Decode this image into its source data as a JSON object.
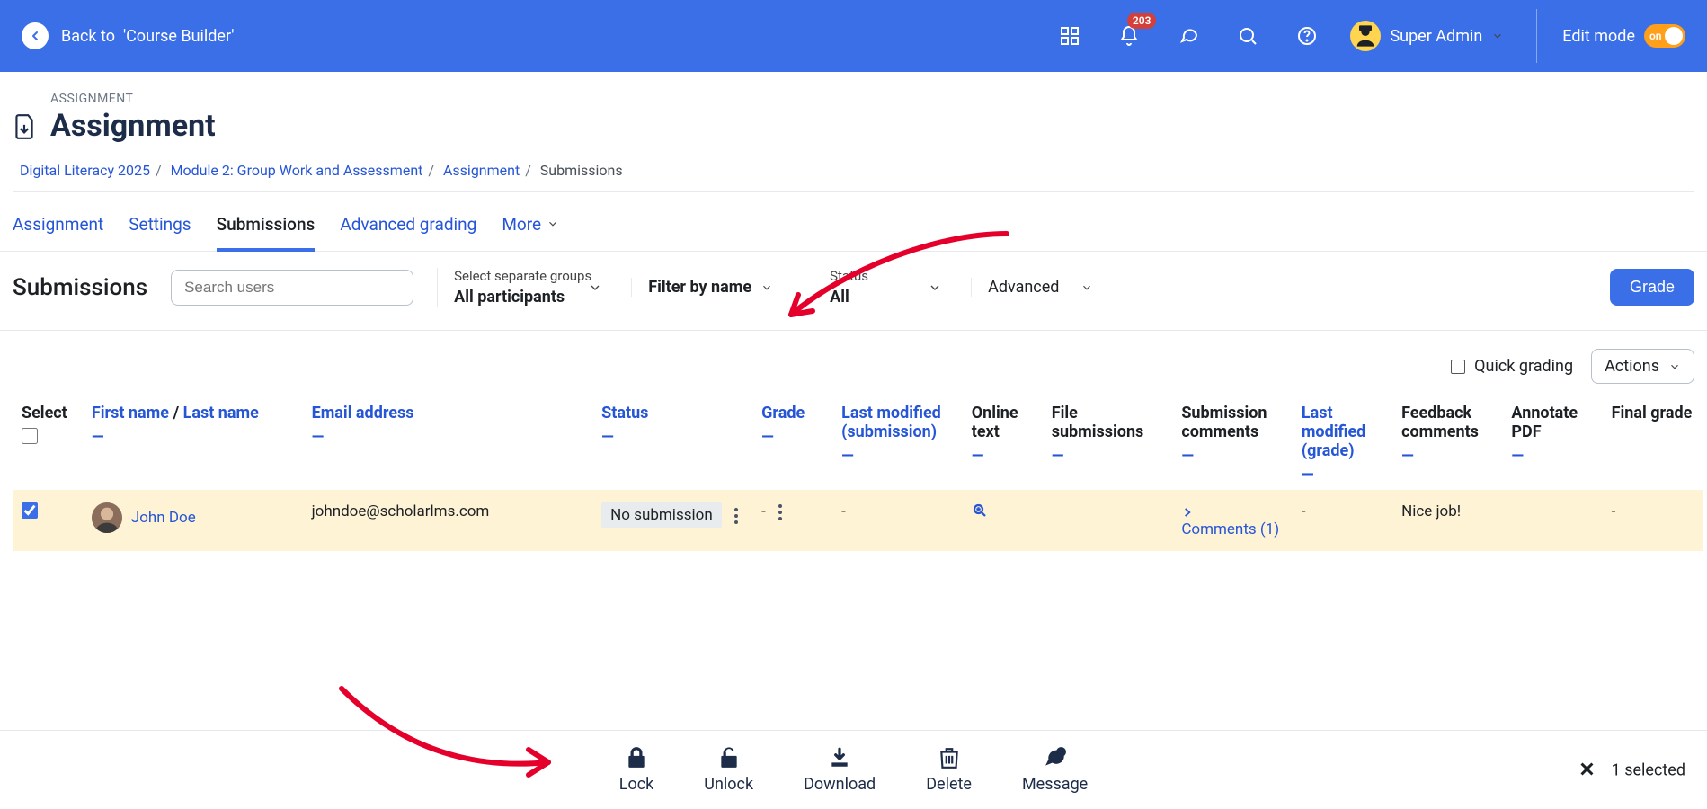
{
  "topbar": {
    "back_prefix": "Back to ",
    "back_target": "'Course Builder'",
    "notif_badge": "203",
    "user_name": "Super Admin",
    "edit_label": "Edit mode",
    "toggle_state": "on"
  },
  "header": {
    "eyebrow": "ASSIGNMENT",
    "title": "Assignment"
  },
  "breadcrumbs": {
    "items": [
      "Digital Literacy 2025",
      "Module 2: Group Work and Assessment",
      "Assignment",
      "Submissions"
    ]
  },
  "tabs": {
    "items": [
      "Assignment",
      "Settings",
      "Submissions",
      "Advanced grading",
      "More"
    ],
    "active_index": 2
  },
  "filters": {
    "section_title": "Submissions",
    "search_placeholder": "Search users",
    "group_label": "Select separate groups",
    "group_value": "All participants",
    "name_filter": "Filter by name",
    "status_label": "Status",
    "status_value": "All",
    "advanced_label": "Advanced",
    "grade_button": "Grade",
    "quick_grading": "Quick grading",
    "actions_dd": "Actions"
  },
  "table": {
    "cols": {
      "select": "Select",
      "first_name": "First name",
      "last_name": "Last name",
      "email": "Email address",
      "status": "Status",
      "grade": "Grade",
      "lm_sub": "Last modified (submission)",
      "online_text": "Online text",
      "file_sub": "File submissions",
      "sub_comments": "Submission comments",
      "lm_grade": "Last modified (grade)",
      "feedback": "Feedback comments",
      "annotate": "Annotate PDF",
      "final": "Final grade"
    },
    "rows": [
      {
        "selected": true,
        "name": "John Doe",
        "email": "johndoe@scholarlms.com",
        "status": "No submission",
        "grade": "-",
        "lm_sub": "-",
        "online_text_icon": "zoom",
        "file_sub": "",
        "comments_label": "Comments (1)",
        "lm_grade": "-",
        "feedback": "Nice job!",
        "final": "-"
      }
    ]
  },
  "bottombar": {
    "actions": [
      "Lock",
      "Unlock",
      "Download",
      "Delete",
      "Message"
    ],
    "selected_text": "1 selected"
  }
}
